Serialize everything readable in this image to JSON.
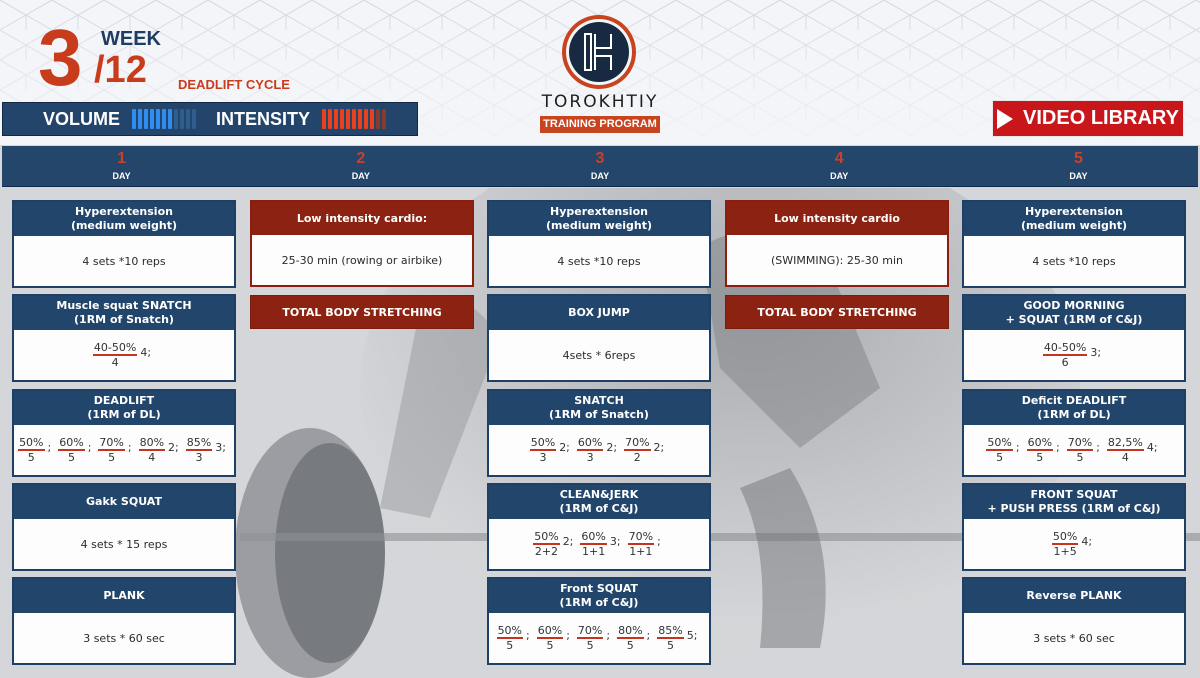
{
  "header": {
    "week_current": "3",
    "week_label": "WEEK",
    "week_total": "/12",
    "cycle_label": "DEADLIFT CYCLE",
    "volume_label": "VOLUME",
    "volume_level": {
      "filled": 7,
      "total": 11
    },
    "intensity_label": "INTENSITY",
    "intensity_level": {
      "filled": 9,
      "total": 11
    },
    "brand_name": "TOROKHTIY",
    "brand_sub": "TRAINING PROGRAM",
    "video_library_label": "VIDEO LIBRARY"
  },
  "colors": {
    "navy": "#22456c",
    "accent_red": "#c83c1c",
    "cardio_red": "#8c2312",
    "video_red": "#c9161b",
    "volume_blue": "#2f8df0",
    "intensity_orange": "#e8411e"
  },
  "days": [
    {
      "number": "1",
      "label": "DAY"
    },
    {
      "number": "2",
      "label": "DAY"
    },
    {
      "number": "3",
      "label": "DAY"
    },
    {
      "number": "4",
      "label": "DAY"
    },
    {
      "number": "5",
      "label": "DAY"
    }
  ],
  "day1": [
    {
      "title": [
        "Hyperextension",
        "(medium weight)"
      ],
      "text": "4 sets *10 reps"
    },
    {
      "title": [
        "Muscle squat SNATCH",
        "(1RM of Snatch)"
      ],
      "sets": [
        {
          "num": "40-50%",
          "den": "4",
          "after": "4;"
        }
      ]
    },
    {
      "title": [
        "DEADLIFT",
        "(1RM of DL)"
      ],
      "sets": [
        {
          "num": "50%",
          "den": "5",
          "after": ";"
        },
        {
          "num": "60%",
          "den": "5",
          "after": ";"
        },
        {
          "num": "70%",
          "den": "5",
          "after": ";"
        },
        {
          "num": "80%",
          "den": "4",
          "after": "2;"
        },
        {
          "num": "85%",
          "den": "3",
          "after": "3;"
        }
      ]
    },
    {
      "title": [
        "Gakk SQUAT"
      ],
      "text": "4 sets * 15 reps"
    },
    {
      "title": [
        "PLANK"
      ],
      "text": "3 sets * 60 sec"
    }
  ],
  "day2": {
    "cardio_title": "Low intensity cardio:",
    "cardio_text": "25-30 min  (rowing or airbike)",
    "stretch": "TOTAL BODY STRETCHING"
  },
  "day3": [
    {
      "title": [
        "Hyperextension",
        "(medium weight)"
      ],
      "text": "4 sets *10 reps"
    },
    {
      "title": [
        "BOX JUMP"
      ],
      "text": "4sets * 6reps"
    },
    {
      "title": [
        "SNATCH",
        "(1RM of Snatch)"
      ],
      "sets": [
        {
          "num": "50%",
          "den": "3",
          "after": "2;"
        },
        {
          "num": "60%",
          "den": "3",
          "after": "2;"
        },
        {
          "num": "70%",
          "den": "2",
          "after": "2;"
        }
      ]
    },
    {
      "title": [
        "CLEAN&JERK",
        "(1RM of C&J)"
      ],
      "sets": [
        {
          "num": "50%",
          "den": "2+2",
          "after": "2;"
        },
        {
          "num": "60%",
          "den": "1+1",
          "after": "3;"
        },
        {
          "num": "70%",
          "den": "1+1",
          "after": ";"
        }
      ]
    },
    {
      "title": [
        "Front SQUAT",
        "(1RM of C&J)"
      ],
      "sets": [
        {
          "num": "50%",
          "den": "5",
          "after": ";"
        },
        {
          "num": "60%",
          "den": "5",
          "after": ";"
        },
        {
          "num": "70%",
          "den": "5",
          "after": ";"
        },
        {
          "num": "80%",
          "den": "5",
          "after": ";"
        },
        {
          "num": "85%",
          "den": "5",
          "after": "5;"
        }
      ]
    }
  ],
  "day4": {
    "cardio_title": "Low intensity cardio",
    "cardio_text": "(SWIMMING): 25-30 min",
    "stretch": "TOTAL BODY STRETCHING"
  },
  "day5": [
    {
      "title": [
        "Hyperextension",
        "(medium weight)"
      ],
      "text": "4 sets *10 reps"
    },
    {
      "title": [
        "GOOD MORNING",
        "+ SQUAT (1RM of C&J)"
      ],
      "sets": [
        {
          "num": "40-50%",
          "den": "6",
          "after": "3;"
        }
      ]
    },
    {
      "title": [
        "Deficit DEADLIFT",
        "(1RM of DL)"
      ],
      "sets": [
        {
          "num": "50%",
          "den": "5",
          "after": ";"
        },
        {
          "num": "60%",
          "den": "5",
          "after": ";"
        },
        {
          "num": "70%",
          "den": "5",
          "after": ";"
        },
        {
          "num": "82,5%",
          "den": "4",
          "after": "4;"
        }
      ]
    },
    {
      "title": [
        "FRONT SQUAT",
        "+ PUSH PRESS (1RM of C&J)"
      ],
      "sets": [
        {
          "num": "50%",
          "den": "1+5",
          "after": "4;"
        }
      ]
    },
    {
      "title": [
        "Reverse PLANK"
      ],
      "text": "3 sets * 60 sec"
    }
  ]
}
